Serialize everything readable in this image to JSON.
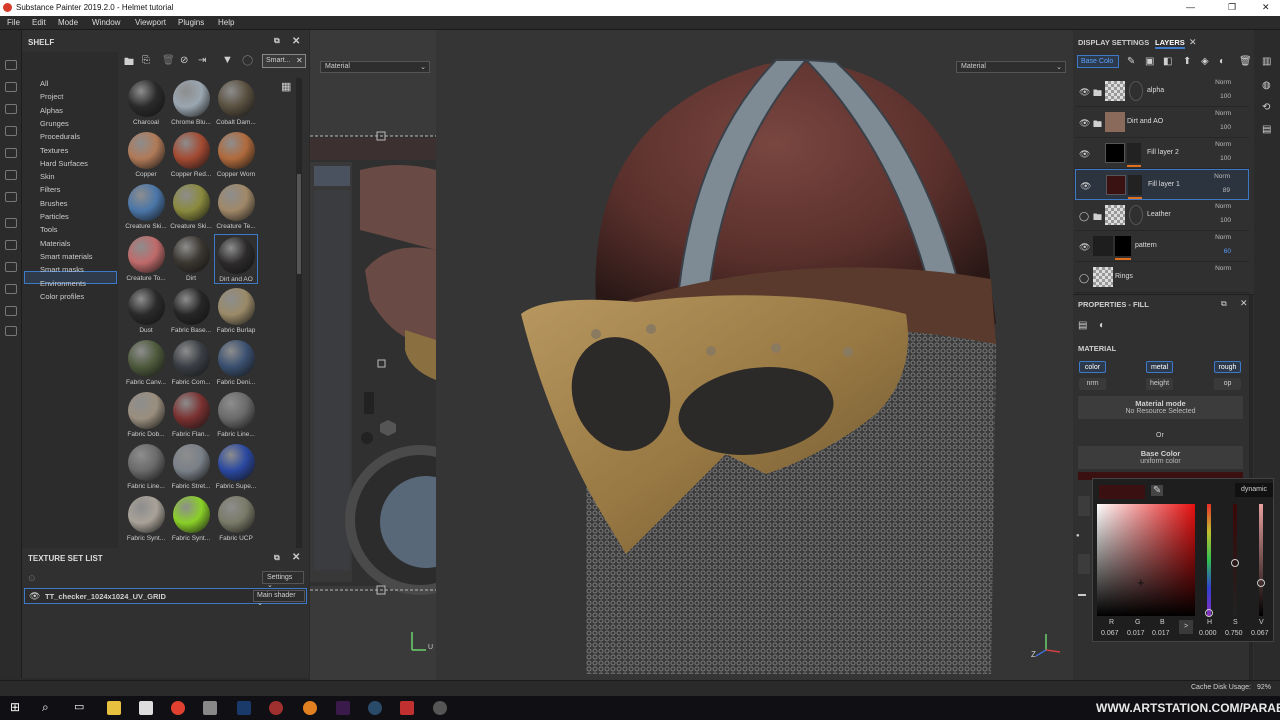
{
  "window": {
    "title": "Substance Painter 2019.2.0 - Helmet tutorial",
    "controls": [
      "—",
      "❐",
      "✕"
    ]
  },
  "menu": [
    "File",
    "Edit",
    "Mode",
    "Window",
    "Viewport",
    "Plugins",
    "Help"
  ],
  "shelf": {
    "title": "SHELF",
    "search_tag": "Smart...",
    "search_placeholder": "Search...",
    "categories": [
      "All",
      "Project",
      "Alphas",
      "Grunges",
      "Procedurals",
      "Textures",
      "Hard Surfaces",
      "Skin",
      "Filters",
      "Brushes",
      "Particles",
      "Tools",
      "Materials",
      "Smart materials",
      "Smart masks",
      "Environments",
      "Color profiles"
    ],
    "selected_category": "Smart materials",
    "items": [
      {
        "name": "Charcoal",
        "color": "#2a2a2a"
      },
      {
        "name": "Chrome Blu...",
        "color": "#9aa6b0"
      },
      {
        "name": "Cobalt Dam...",
        "color": "#5a5040"
      },
      {
        "name": "Copper",
        "color": "#b07a58"
      },
      {
        "name": "Copper Red...",
        "color": "#a34a32"
      },
      {
        "name": "Copper Worn",
        "color": "#b06a3c"
      },
      {
        "name": "Creature Ski...",
        "color": "#4a76a8"
      },
      {
        "name": "Creature Ski...",
        "color": "#8a8a3e"
      },
      {
        "name": "Creature Te...",
        "color": "#a08868"
      },
      {
        "name": "Creature To...",
        "color": "#c06a6a"
      },
      {
        "name": "Dirt",
        "color": "#3a3630"
      },
      {
        "name": "Dirt and AO",
        "color": "#2c2a2a"
      },
      {
        "name": "Dust",
        "color": "#2a2a2a"
      },
      {
        "name": "Fabric Base...",
        "color": "#262626"
      },
      {
        "name": "Fabric Burlap",
        "color": "#9a8a68"
      },
      {
        "name": "Fabric Canv...",
        "color": "#4e5a3c"
      },
      {
        "name": "Fabric Com...",
        "color": "#3a3e44"
      },
      {
        "name": "Fabric Deni...",
        "color": "#3a5070"
      },
      {
        "name": "Fabric Dob...",
        "color": "#9a8e7e"
      },
      {
        "name": "Fabric Flan...",
        "color": "#7a3030"
      },
      {
        "name": "Fabric Line...",
        "color": "#6a6a6a"
      },
      {
        "name": "Fabric Line...",
        "color": "#6a6a6a"
      },
      {
        "name": "Fabric Stret...",
        "color": "#7a8088"
      },
      {
        "name": "Fabric Supe...",
        "color": "#2a48a0"
      },
      {
        "name": "Fabric Synt...",
        "color": "#a8a298"
      },
      {
        "name": "Fabric Synt...",
        "color": "#8ad028"
      },
      {
        "name": "Fabric UCP",
        "color": "#7a7a68"
      }
    ],
    "selected_item": 11
  },
  "texture_set": {
    "title": "TEXTURE SET LIST",
    "settings": "Settings",
    "item": "TT_checker_1024x1024_UV_GRID",
    "shader": "Main shader"
  },
  "viewport": {
    "left_mode": "Material",
    "right_mode": "Material"
  },
  "layers_panel": {
    "tabs": [
      "DISPLAY SETTINGS",
      "LAYERS"
    ],
    "channel": "Base Colo",
    "layers": [
      {
        "name": "alpha",
        "blend": "Norm",
        "opacity": "100"
      },
      {
        "name": "Dirt and AO",
        "blend": "Norm",
        "opacity": "100"
      },
      {
        "name": "Fill layer 2",
        "blend": "Norm",
        "opacity": "100"
      },
      {
        "name": "Fill layer 1",
        "blend": "Norm",
        "opacity": "89"
      },
      {
        "name": "Leather",
        "blend": "Norm",
        "opacity": "100"
      },
      {
        "name": "pattern",
        "blend": "Norm",
        "opacity": "60"
      },
      {
        "name": "Rings",
        "blend": "Norm",
        "opacity": ""
      }
    ],
    "selected_layer": 3
  },
  "properties": {
    "title": "PROPERTIES - FILL",
    "section": "MATERIAL",
    "channels_row1": [
      "color",
      "metal",
      "rough"
    ],
    "channels_row2": [
      "nrm",
      "height",
      "op"
    ],
    "material_mode_label": "Material mode",
    "material_mode_value": "No Resource Selected",
    "or_label": "Or",
    "base_color_label": "Base Color",
    "base_color_value": "uniform color"
  },
  "color_picker": {
    "tooltip": "dynamic",
    "labels": [
      "R",
      "G",
      "B",
      "H",
      "S",
      "V"
    ],
    "values": [
      "0.067",
      "0.017",
      "0.017",
      "0.000",
      "0.750",
      "0.067"
    ],
    "arrow": ">"
  },
  "status": {
    "cache": "Cache Disk Usage:",
    "cache_value": "92%"
  },
  "watermark": "WWW.ARTSTATION.COM/PARABOX",
  "axis": {
    "u": "U",
    "z": "Z"
  }
}
